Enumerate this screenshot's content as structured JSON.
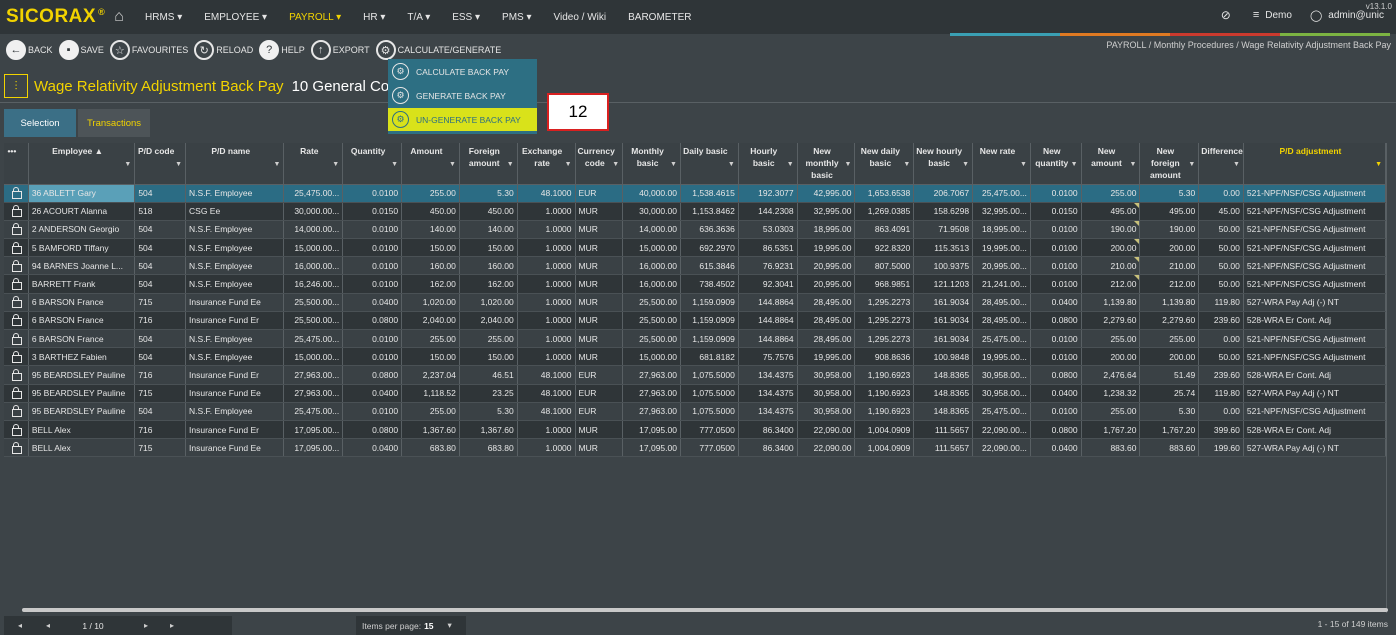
{
  "app": {
    "logo": "SICORAX",
    "logo_mark": "®",
    "version": "v13.1.0",
    "user_demo": "Demo",
    "user_admin": "admin@unic"
  },
  "menu": [
    "HRMS ▾",
    "EMPLOYEE ▾",
    "PAYROLL ▾",
    "HR ▾",
    "T/A ▾",
    "ESS ▾",
    "PMS ▾",
    "Video / Wiki",
    "BAROMETER"
  ],
  "menu_active_index": 2,
  "colors": {
    "accent_teal": "#3aa0b4",
    "accent_orange": "#e07a22",
    "accent_red": "#cc3a2e",
    "accent_green": "#7cb342",
    "brand_yellow": "#f2d300"
  },
  "toolbar": {
    "back": "BACK",
    "save": "SAVE",
    "favourites": "FAVOURITES",
    "reload": "RELOAD",
    "help": "HELP",
    "export": "EXPORT",
    "calculate": "CALCULATE/GENERATE"
  },
  "breadcrumb": "PAYROLL /  Monthly Procedures /  Wage Relativity Adjustment Back Pay",
  "page": {
    "title": "Wage Relativity Adjustment Back Pay",
    "company": "10 General Co L"
  },
  "dropdown": [
    "CALCULATE BACK PAY",
    "GENERATE BACK PAY",
    "UN-GENERATE BACK PAY"
  ],
  "callout": "12",
  "tabs": {
    "selection": "Selection",
    "transactions": "Transactions"
  },
  "columns": [
    "•••",
    "Employee ▲",
    "P/D code",
    "P/D name",
    "Rate",
    "Quantity",
    "Amount",
    "Foreign amount",
    "Exchange rate",
    "Currency code",
    "Monthly basic",
    "Daily basic",
    "Hourly basic",
    "New monthly basic",
    "New daily basic",
    "New hourly basic",
    "New rate",
    "New quantity",
    "New amount",
    "New foreign amount",
    "Difference",
    "P/D adjustment"
  ],
  "rows": [
    [
      "",
      "36 ABLETT Gary",
      "504",
      "N.S.F. Employee",
      "25,475.00...",
      "0.0100",
      "255.00",
      "5.30",
      "48.1000",
      "EUR",
      "40,000.00",
      "1,538.4615",
      "192.3077",
      "42,995.00",
      "1,653.6538",
      "206.7067",
      "25,475.00...",
      "0.0100",
      "255.00",
      "5.30",
      "0.00",
      "521-NPF/NSF/CSG Adjustment"
    ],
    [
      "",
      "26 ACOURT Alanna",
      "518",
      "CSG Ee",
      "30,000.00...",
      "0.0150",
      "450.00",
      "450.00",
      "1.0000",
      "MUR",
      "30,000.00",
      "1,153.8462",
      "144.2308",
      "32,995.00",
      "1,269.0385",
      "158.6298",
      "32,995.00...",
      "0.0150",
      "495.00",
      "495.00",
      "45.00",
      "521-NPF/NSF/CSG Adjustment"
    ],
    [
      "",
      "2 ANDERSON Georgio",
      "504",
      "N.S.F. Employee",
      "14,000.00...",
      "0.0100",
      "140.00",
      "140.00",
      "1.0000",
      "MUR",
      "14,000.00",
      "636.3636",
      "53.0303",
      "18,995.00",
      "863.4091",
      "71.9508",
      "18,995.00...",
      "0.0100",
      "190.00",
      "190.00",
      "50.00",
      "521-NPF/NSF/CSG Adjustment"
    ],
    [
      "",
      "5 BAMFORD Tiffany",
      "504",
      "N.S.F. Employee",
      "15,000.00...",
      "0.0100",
      "150.00",
      "150.00",
      "1.0000",
      "MUR",
      "15,000.00",
      "692.2970",
      "86.5351",
      "19,995.00",
      "922.8320",
      "115.3513",
      "19,995.00...",
      "0.0100",
      "200.00",
      "200.00",
      "50.00",
      "521-NPF/NSF/CSG Adjustment"
    ],
    [
      "",
      "94 BARNES Joanne L...",
      "504",
      "N.S.F. Employee",
      "16,000.00...",
      "0.0100",
      "160.00",
      "160.00",
      "1.0000",
      "MUR",
      "16,000.00",
      "615.3846",
      "76.9231",
      "20,995.00",
      "807.5000",
      "100.9375",
      "20,995.00...",
      "0.0100",
      "210.00",
      "210.00",
      "50.00",
      "521-NPF/NSF/CSG Adjustment"
    ],
    [
      "",
      "BARRETT Frank",
      "504",
      "N.S.F. Employee",
      "16,246.00...",
      "0.0100",
      "162.00",
      "162.00",
      "1.0000",
      "MUR",
      "16,000.00",
      "738.4502",
      "92.3041",
      "20,995.00",
      "968.9851",
      "121.1203",
      "21,241.00...",
      "0.0100",
      "212.00",
      "212.00",
      "50.00",
      "521-NPF/NSF/CSG Adjustment"
    ],
    [
      "",
      "6 BARSON France",
      "715",
      "Insurance Fund Ee",
      "25,500.00...",
      "0.0400",
      "1,020.00",
      "1,020.00",
      "1.0000",
      "MUR",
      "25,500.00",
      "1,159.0909",
      "144.8864",
      "28,495.00",
      "1,295.2273",
      "161.9034",
      "28,495.00...",
      "0.0400",
      "1,139.80",
      "1,139.80",
      "119.80",
      "527-WRA Pay Adj (-) NT"
    ],
    [
      "",
      "6 BARSON France",
      "716",
      "Insurance Fund Er",
      "25,500.00...",
      "0.0800",
      "2,040.00",
      "2,040.00",
      "1.0000",
      "MUR",
      "25,500.00",
      "1,159.0909",
      "144.8864",
      "28,495.00",
      "1,295.2273",
      "161.9034",
      "28,495.00...",
      "0.0800",
      "2,279.60",
      "2,279.60",
      "239.60",
      "528-WRA Er Cont. Adj"
    ],
    [
      "",
      "6 BARSON France",
      "504",
      "N.S.F. Employee",
      "25,475.00...",
      "0.0100",
      "255.00",
      "255.00",
      "1.0000",
      "MUR",
      "25,500.00",
      "1,159.0909",
      "144.8864",
      "28,495.00",
      "1,295.2273",
      "161.9034",
      "25,475.00...",
      "0.0100",
      "255.00",
      "255.00",
      "0.00",
      "521-NPF/NSF/CSG Adjustment"
    ],
    [
      "",
      "3 BARTHEZ Fabien",
      "504",
      "N.S.F. Employee",
      "15,000.00...",
      "0.0100",
      "150.00",
      "150.00",
      "1.0000",
      "MUR",
      "15,000.00",
      "681.8182",
      "75.7576",
      "19,995.00",
      "908.8636",
      "100.9848",
      "19,995.00...",
      "0.0100",
      "200.00",
      "200.00",
      "50.00",
      "521-NPF/NSF/CSG Adjustment"
    ],
    [
      "",
      "95 BEARDSLEY Pauline",
      "716",
      "Insurance Fund Er",
      "27,963.00...",
      "0.0800",
      "2,237.04",
      "46.51",
      "48.1000",
      "EUR",
      "27,963.00",
      "1,075.5000",
      "134.4375",
      "30,958.00",
      "1,190.6923",
      "148.8365",
      "30,958.00...",
      "0.0800",
      "2,476.64",
      "51.49",
      "239.60",
      "528-WRA Er Cont. Adj"
    ],
    [
      "",
      "95 BEARDSLEY Pauline",
      "715",
      "Insurance Fund Ee",
      "27,963.00...",
      "0.0400",
      "1,118.52",
      "23.25",
      "48.1000",
      "EUR",
      "27,963.00",
      "1,075.5000",
      "134.4375",
      "30,958.00",
      "1,190.6923",
      "148.8365",
      "30,958.00...",
      "0.0400",
      "1,238.32",
      "25.74",
      "119.80",
      "527-WRA Pay Adj (-) NT"
    ],
    [
      "",
      "95 BEARDSLEY Pauline",
      "504",
      "N.S.F. Employee",
      "25,475.00...",
      "0.0100",
      "255.00",
      "5.30",
      "48.1000",
      "EUR",
      "27,963.00",
      "1,075.5000",
      "134.4375",
      "30,958.00",
      "1,190.6923",
      "148.8365",
      "25,475.00...",
      "0.0100",
      "255.00",
      "5.30",
      "0.00",
      "521-NPF/NSF/CSG Adjustment"
    ],
    [
      "",
      "BELL Alex",
      "716",
      "Insurance Fund Er",
      "17,095.00...",
      "0.0800",
      "1,367.60",
      "1,367.60",
      "1.0000",
      "MUR",
      "17,095.00",
      "777.0500",
      "86.3400",
      "22,090.00",
      "1,004.0909",
      "111.5657",
      "22,090.00...",
      "0.0800",
      "1,767.20",
      "1,767.20",
      "399.60",
      "528-WRA Er Cont. Adj"
    ],
    [
      "",
      "BELL Alex",
      "715",
      "Insurance Fund Ee",
      "17,095.00...",
      "0.0400",
      "683.80",
      "683.80",
      "1.0000",
      "MUR",
      "17,095.00",
      "777.0500",
      "86.3400",
      "22,090.00",
      "1,004.0909",
      "111.5657",
      "22,090.00...",
      "0.0400",
      "883.60",
      "883.60",
      "199.60",
      "527-WRA Pay Adj (-) NT"
    ]
  ],
  "pager": {
    "first": "◂",
    "prev": "◂",
    "page": "1 / 10",
    "next": "▸",
    "last": "▸"
  },
  "items_per_page": {
    "label": "Items per page:",
    "value": "15",
    "arrow": "▾"
  },
  "total_text": "1 - 15 of 149 items"
}
